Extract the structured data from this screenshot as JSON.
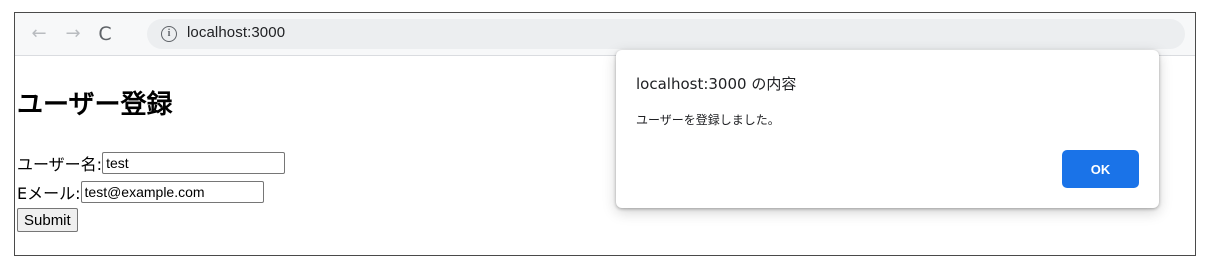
{
  "browser": {
    "url": "localhost:3000",
    "back_icon": "←",
    "forward_icon": "→",
    "reload_icon": "C",
    "info_icon": "i"
  },
  "page": {
    "title": "ユーザー登録",
    "form": {
      "username_label": "ユーザー名:",
      "username_value": "test",
      "email_label": "Eメール:",
      "email_value": "test@example.com",
      "submit_label": "Submit"
    }
  },
  "dialog": {
    "title": "localhost:3000 の内容",
    "message": "ユーザーを登録しました。",
    "ok_label": "OK",
    "ok_color": "#1a73e8"
  }
}
